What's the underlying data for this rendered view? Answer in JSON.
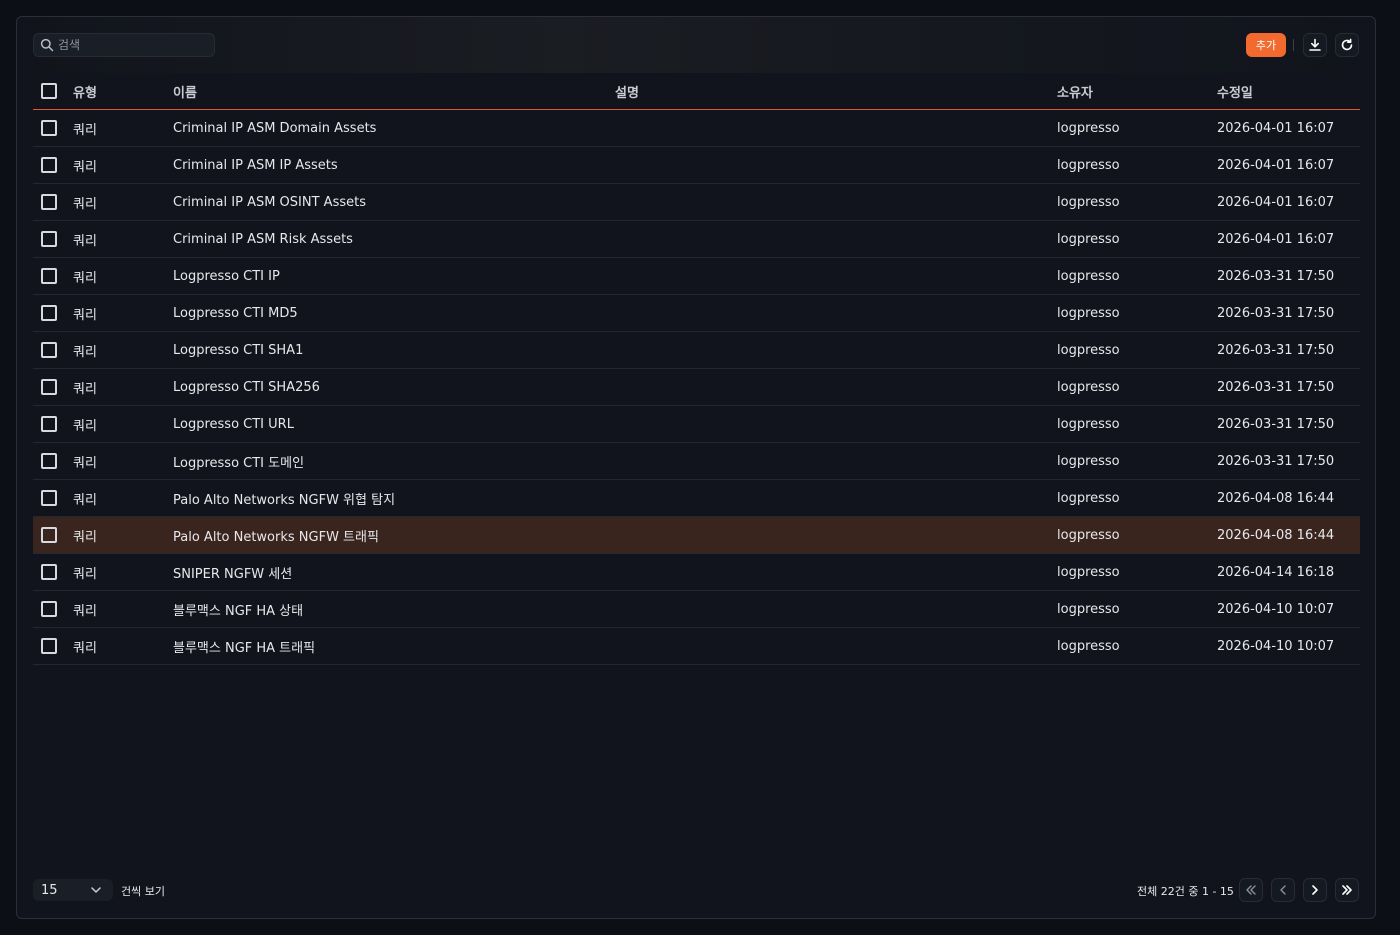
{
  "toolbar": {
    "search_placeholder": "검색",
    "add_label": "추가"
  },
  "table": {
    "headers": {
      "type": "유형",
      "name": "이름",
      "description": "설명",
      "owner": "소유자",
      "modified": "수정일"
    },
    "rows": [
      {
        "type": "쿼리",
        "name": "Criminal IP ASM Domain Assets",
        "description": "",
        "owner": "logpresso",
        "modified": "2026-04-01 16:07"
      },
      {
        "type": "쿼리",
        "name": "Criminal IP ASM IP Assets",
        "description": "",
        "owner": "logpresso",
        "modified": "2026-04-01 16:07"
      },
      {
        "type": "쿼리",
        "name": "Criminal IP ASM OSINT Assets",
        "description": "",
        "owner": "logpresso",
        "modified": "2026-04-01 16:07"
      },
      {
        "type": "쿼리",
        "name": "Criminal IP ASM Risk Assets",
        "description": "",
        "owner": "logpresso",
        "modified": "2026-04-01 16:07"
      },
      {
        "type": "쿼리",
        "name": "Logpresso CTI IP",
        "description": "",
        "owner": "logpresso",
        "modified": "2026-03-31 17:50"
      },
      {
        "type": "쿼리",
        "name": "Logpresso CTI MD5",
        "description": "",
        "owner": "logpresso",
        "modified": "2026-03-31 17:50"
      },
      {
        "type": "쿼리",
        "name": "Logpresso CTI SHA1",
        "description": "",
        "owner": "logpresso",
        "modified": "2026-03-31 17:50"
      },
      {
        "type": "쿼리",
        "name": "Logpresso CTI SHA256",
        "description": "",
        "owner": "logpresso",
        "modified": "2026-03-31 17:50"
      },
      {
        "type": "쿼리",
        "name": "Logpresso CTI URL",
        "description": "",
        "owner": "logpresso",
        "modified": "2026-03-31 17:50"
      },
      {
        "type": "쿼리",
        "name": "Logpresso CTI 도메인",
        "description": "",
        "owner": "logpresso",
        "modified": "2026-03-31 17:50"
      },
      {
        "type": "쿼리",
        "name": "Palo Alto Networks NGFW 위협 탐지",
        "description": "",
        "owner": "logpresso",
        "modified": "2026-04-08 16:44"
      },
      {
        "type": "쿼리",
        "name": "Palo Alto Networks NGFW 트래픽",
        "description": "",
        "owner": "logpresso",
        "modified": "2026-04-08 16:44"
      },
      {
        "type": "쿼리",
        "name": "SNIPER NGFW 세션",
        "description": "",
        "owner": "logpresso",
        "modified": "2026-04-14 16:18"
      },
      {
        "type": "쿼리",
        "name": "블루맥스 NGF HA 상태",
        "description": "",
        "owner": "logpresso",
        "modified": "2026-04-10 10:07"
      },
      {
        "type": "쿼리",
        "name": "블루맥스 NGF HA 트래픽",
        "description": "",
        "owner": "logpresso",
        "modified": "2026-04-10 10:07"
      }
    ],
    "highlighted_row": 11
  },
  "footer": {
    "page_size": "15",
    "page_size_label": "건씩 보기",
    "range_text": "전체 22건 중 1 - 15"
  },
  "colors": {
    "accent": "#f26a2e",
    "highlight_row": "#3a241e",
    "background": "#11141c"
  }
}
